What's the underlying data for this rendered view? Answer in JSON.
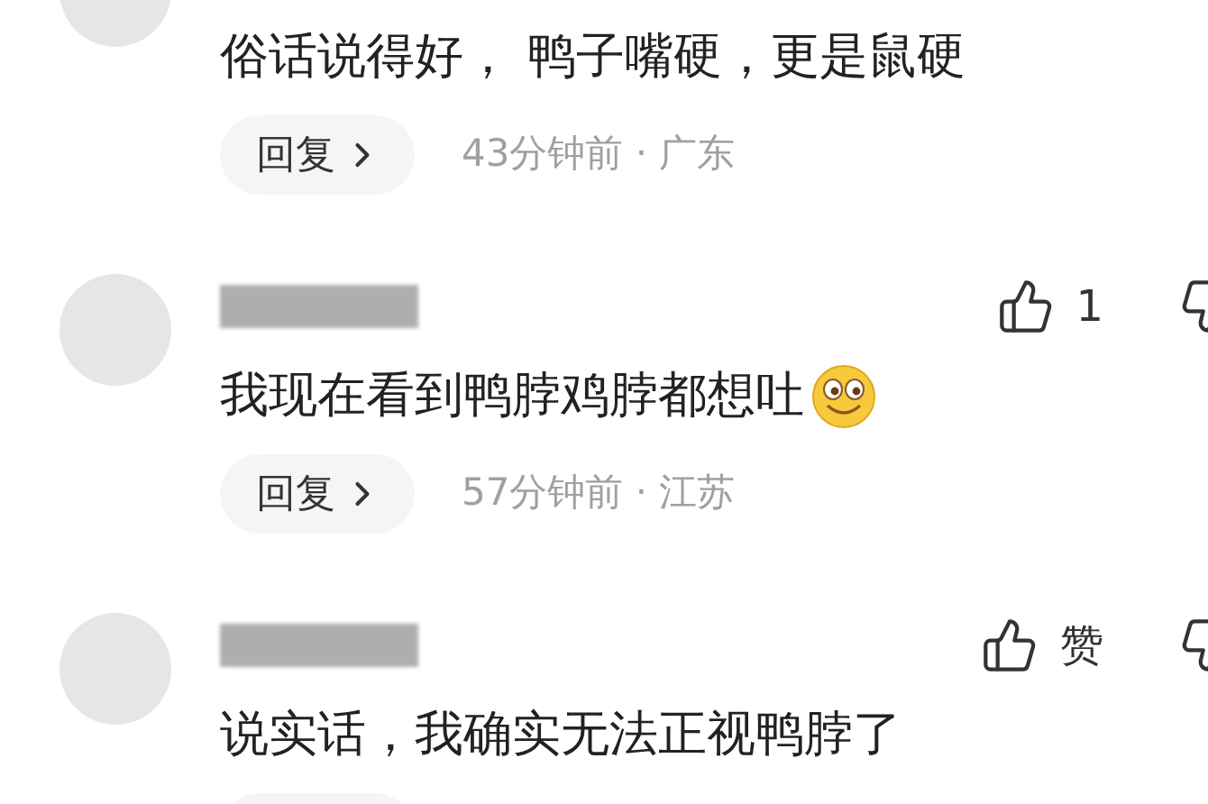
{
  "comments": [
    {
      "text": "俗话说得好， 鸭子嘴硬，更是鼠硬",
      "emoji": false,
      "reply": "回复",
      "meta": "43分钟前 · 广东"
    },
    {
      "like": "1",
      "text": "我现在看到鸭脖鸡脖都想吐",
      "emoji": true,
      "reply": "回复",
      "meta": "57分钟前 · 江苏"
    },
    {
      "like": "赞",
      "text": "说实话，我确实无法正视鸭脖了",
      "emoji": false
    }
  ]
}
